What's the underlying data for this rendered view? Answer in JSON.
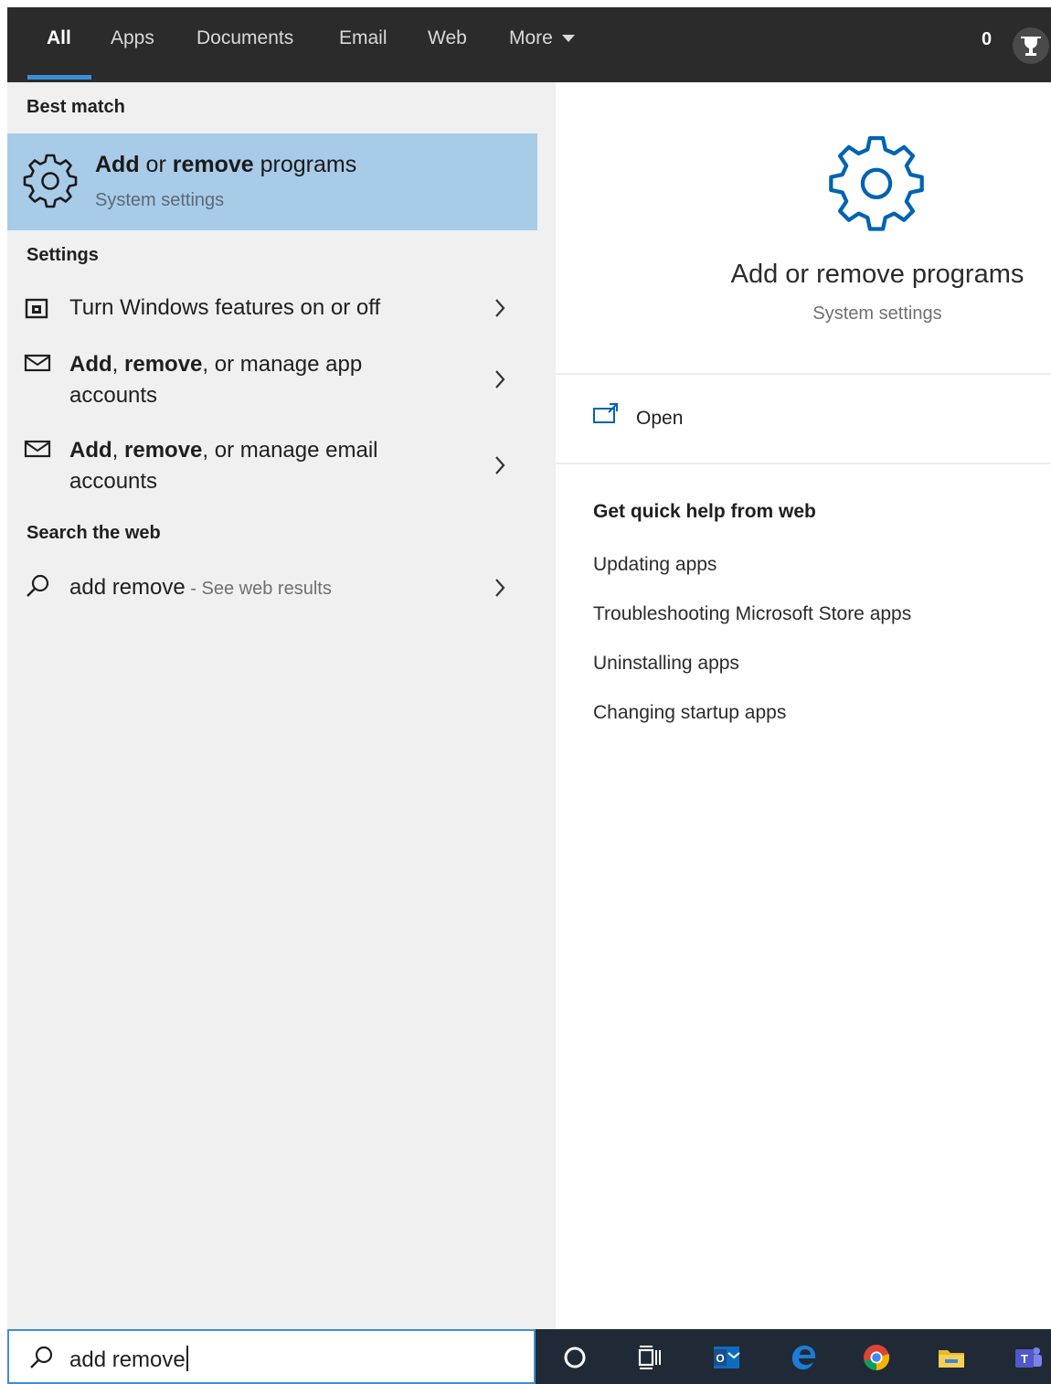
{
  "tabs": [
    {
      "label": "All",
      "active": true
    },
    {
      "label": "Apps"
    },
    {
      "label": "Documents"
    },
    {
      "label": "Email"
    },
    {
      "label": "Web"
    },
    {
      "label": "More"
    }
  ],
  "rewards_points": "0",
  "best_match": {
    "heading": "Best match",
    "title_add": "Add",
    "title_or": " or ",
    "title_remove": "remove",
    "title_programs": " programs",
    "subtitle": "System settings",
    "icon": "gear-icon"
  },
  "settings": {
    "heading": "Settings",
    "items": [
      {
        "pre": "",
        "bold1": "",
        "mid": "",
        "bold2": "",
        "post": "Turn Windows features on or off",
        "icon": "windows-features-icon"
      },
      {
        "pre": "",
        "bold1": "Add",
        "mid": ", ",
        "bold2": "remove",
        "post": ", or manage app accounts",
        "icon": "mail-icon"
      },
      {
        "pre": "",
        "bold1": "Add",
        "mid": ", ",
        "bold2": "remove",
        "post": ", or manage email accounts",
        "icon": "mail-icon"
      }
    ]
  },
  "web": {
    "heading": "Search the web",
    "query": "add remove",
    "sep": " - ",
    "sub": "See web results"
  },
  "preview": {
    "title": "Add or remove programs",
    "subtitle": "System settings",
    "open_label": "Open",
    "help_heading": "Get quick help from web",
    "help_links": [
      "Updating apps",
      "Troubleshooting Microsoft Store apps",
      "Uninstalling apps",
      "Changing startup apps"
    ]
  },
  "search": {
    "value": "add remove"
  },
  "taskbar_icons": [
    "cortana-icon",
    "task-view-icon",
    "outlook-icon",
    "edge-icon",
    "chrome-icon",
    "file-explorer-icon",
    "teams-icon"
  ],
  "colors": {
    "accent": "#3b8fd8",
    "highlight": "#a8cbe8",
    "gear_blue": "#0063b1"
  }
}
